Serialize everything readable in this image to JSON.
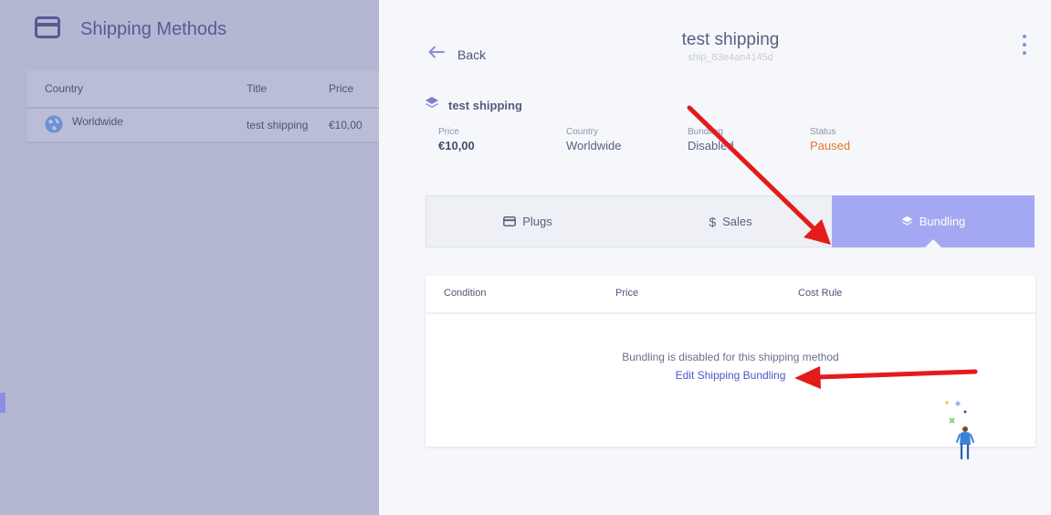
{
  "background": {
    "title": "Shipping Methods",
    "table": {
      "columns": [
        "Country",
        "Title",
        "Price"
      ],
      "row": {
        "country": "Worldwide",
        "title": "test shipping",
        "price": "€10,00"
      }
    }
  },
  "panel": {
    "back_label": "Back",
    "title": "test shipping",
    "subtitle": "ship_83e4an4145d",
    "method_name": "test shipping",
    "info": {
      "price_label": "Price",
      "price_value": "€10,00",
      "country_label": "Country",
      "country_value": "Worldwide",
      "bundling_label": "Bundling",
      "bundling_value": "Disabled",
      "status_label": "Status",
      "status_value": "Paused"
    },
    "tabs": [
      {
        "label": "Plugs",
        "icon": "card-icon"
      },
      {
        "label": "Sales",
        "icon": "dollar-icon"
      },
      {
        "label": "Bundling",
        "icon": "layers-icon",
        "active": true
      }
    ],
    "table": {
      "columns": [
        "Condition",
        "Price",
        "Cost Rule"
      ],
      "empty_message": "Bundling is disabled for this shipping method",
      "empty_link": "Edit Shipping Bundling"
    }
  },
  "colors": {
    "accent": "#a4a8f3",
    "status_paused": "#e8762d",
    "link": "#4b57c9",
    "annotation_arrow": "#e31b1b"
  }
}
